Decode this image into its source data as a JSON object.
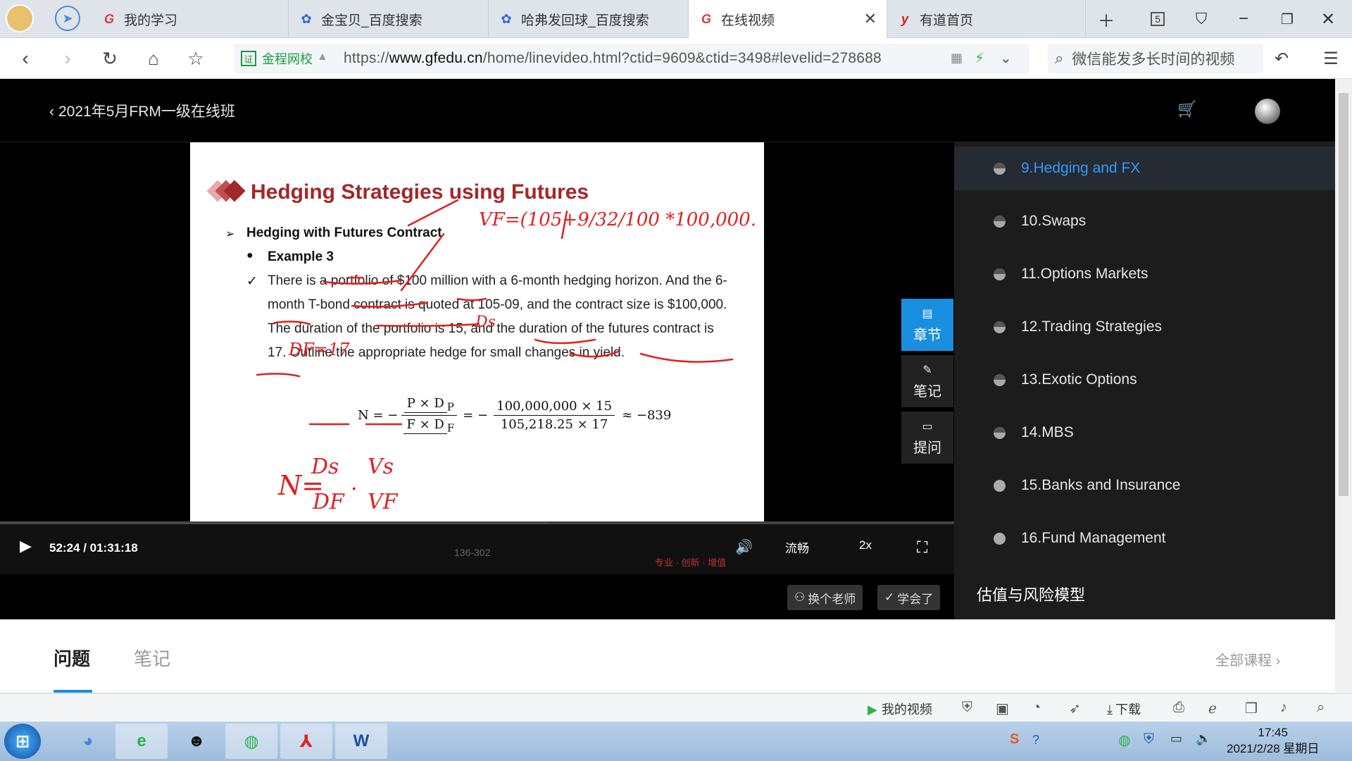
{
  "browser": {
    "tabs": [
      {
        "label": "我的学习",
        "icon": "gfedu-icon"
      },
      {
        "label": "金宝贝_百度搜索",
        "icon": "baidu-icon"
      },
      {
        "label": "哈弗发回球_百度搜索",
        "icon": "baidu-icon"
      },
      {
        "label": "在线视频",
        "icon": "gfedu-icon",
        "active": true
      },
      {
        "label": "有道首页",
        "icon": "youdao-icon"
      }
    ],
    "tab_count": "5",
    "url_site": "金程网校",
    "url_prefix": "https://",
    "url_domain": "www.gfedu.cn",
    "url_path": "/home/linevideo.html?ctid=9609&ctid=3498#levelid=278688",
    "search_text": "微信能发多长时间的视频"
  },
  "header": {
    "course_title": "2021年5月FRM一级在线班"
  },
  "slide": {
    "title": "Hedging Strategies using Futures",
    "bullet1": "Hedging with Futures Contract",
    "bullet2": "Example 3",
    "paragraph": "There is a portfolio of $100 million with a 6-month hedging horizon. And the 6-month T-bond contract is quoted at 105-09, and the  contract size is $100,000. The duration of the portfolio is 15, and the duration of the futures contract is 17. Outline the appropriate hedge for small changes in yield.",
    "formula_lhs": "N = −",
    "formula_num1": "P × D",
    "formula_den1": "F × D",
    "formula_sub_p": "P",
    "formula_sub_f": "F",
    "formula_eq": "= −",
    "formula_num2": "100,000,000 × 15",
    "formula_den2": "105,218.25 × 17",
    "formula_result": "≈ −839",
    "handwriting_top": "VF=(105+9/32/100 *100,000.",
    "handwriting_df": "DF=17",
    "handwriting_ds": "Ds",
    "handwriting_n": "N=",
    "handwriting_frac1_num": "Ds",
    "handwriting_frac1_den": "DF",
    "handwriting_frac2_num": "Vs",
    "handwriting_frac2_den": "VF",
    "page_number": "136-302",
    "watermark": "专业 · 创新 · 增值"
  },
  "player": {
    "timecode": "52:24 / 01:31:18",
    "progress_fraction": 0.574,
    "quality": "流畅",
    "speed": "2x",
    "change_teacher": "换个老师",
    "learned": "学会了"
  },
  "side_buttons": [
    {
      "label": "章节",
      "icon": "list-icon",
      "active": true
    },
    {
      "label": "笔记",
      "icon": "pen-icon"
    },
    {
      "label": "提问",
      "icon": "chat-icon"
    }
  ],
  "chapters": [
    {
      "label": "9.Hedging and FX",
      "state": "active"
    },
    {
      "label": "10.Swaps",
      "state": "half"
    },
    {
      "label": "11.Options Markets",
      "state": "half"
    },
    {
      "label": "12.Trading Strategies",
      "state": "half"
    },
    {
      "label": "13.Exotic Options",
      "state": "half"
    },
    {
      "label": "14.MBS",
      "state": "half"
    },
    {
      "label": "15.Banks and Insurance",
      "state": "empty"
    },
    {
      "label": "16.Fund Management",
      "state": "empty"
    }
  ],
  "section_title": "估值与风险模型",
  "bottom_tabs": {
    "questions": "问题",
    "notes": "笔记",
    "all_courses": "全部课程 ›"
  },
  "statusbar": {
    "my_video": "我的视频",
    "download": "下载"
  },
  "taskbar": {
    "time": "17:45",
    "date": "2021/2/28 星期日"
  },
  "colors": {
    "accent": "#1a8fe0",
    "slide_title": "#a3262a",
    "handwriting": "#e02020",
    "active_chapter": "#2f9bff"
  }
}
